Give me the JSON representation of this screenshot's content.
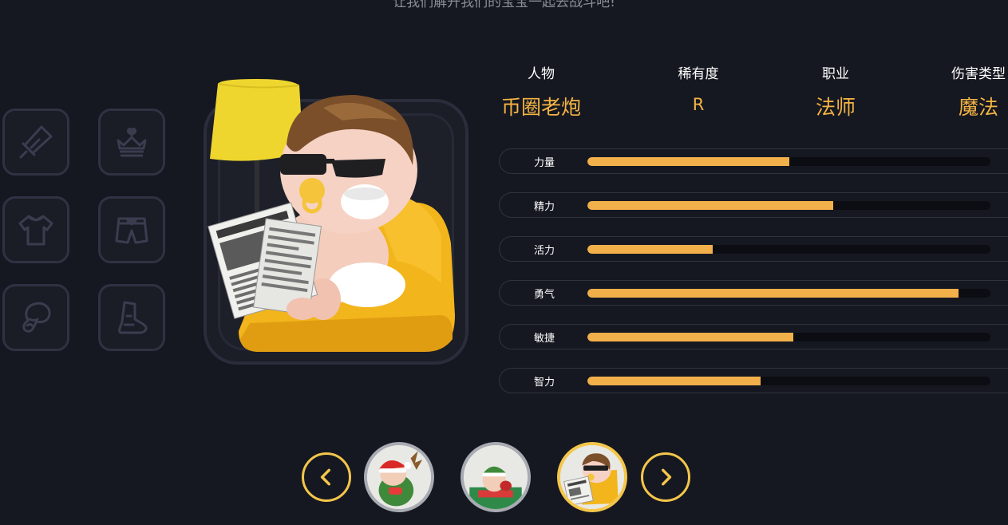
{
  "header": {
    "subtitle": "让我们解开我们的宝宝一起去战斗吧!"
  },
  "equipment_slots": [
    {
      "icon": "sword-icon"
    },
    {
      "icon": "crown-icon"
    },
    {
      "icon": "shirt-icon"
    },
    {
      "icon": "shorts-icon"
    },
    {
      "icon": "glove-icon"
    },
    {
      "icon": "boot-icon"
    }
  ],
  "character": {
    "portrait": "character-portrait",
    "info": [
      {
        "label": "人物",
        "value": "币圈老炮"
      },
      {
        "label": "稀有度",
        "value": "R"
      },
      {
        "label": "职业",
        "value": "法师"
      },
      {
        "label": "伤害类型",
        "value": "魔法"
      }
    ],
    "stats": [
      {
        "label": "力量",
        "value": 0.5
      },
      {
        "label": "精力",
        "value": 0.61
      },
      {
        "label": "活力",
        "value": 0.31
      },
      {
        "label": "勇气",
        "value": 0.92
      },
      {
        "label": "敏捷",
        "value": 0.51
      },
      {
        "label": "智力",
        "value": 0.43
      }
    ]
  },
  "carousel": {
    "prev_icon": "chevron-left-icon",
    "next_icon": "chevron-right-icon",
    "thumbnails": [
      {
        "name": "elf-baby-thumb",
        "active": false
      },
      {
        "name": "sofa-elf-thumb",
        "active": false
      },
      {
        "name": "coin-veteran-thumb",
        "active": true
      }
    ]
  },
  "colors": {
    "background": "#161821",
    "accent": "#f4b443",
    "bar_fill": "#f2b04b",
    "slot_border": "#2f3242"
  }
}
